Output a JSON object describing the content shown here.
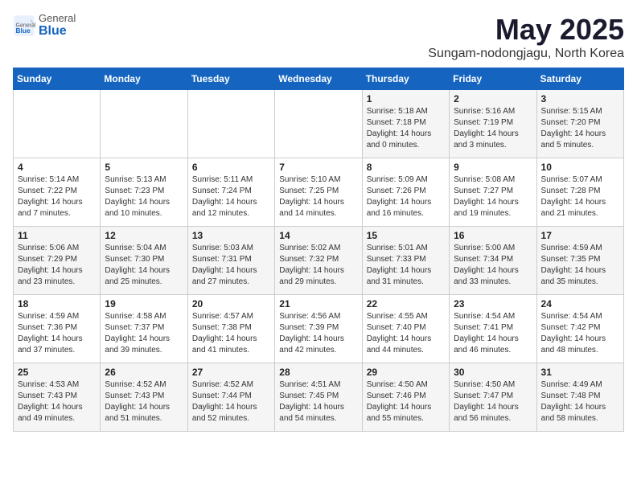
{
  "logo": {
    "general": "General",
    "blue": "Blue"
  },
  "title": "May 2025",
  "subtitle": "Sungam-nodongjagu, North Korea",
  "days_header": [
    "Sunday",
    "Monday",
    "Tuesday",
    "Wednesday",
    "Thursday",
    "Friday",
    "Saturday"
  ],
  "weeks": [
    [
      {
        "day": "",
        "text": ""
      },
      {
        "day": "",
        "text": ""
      },
      {
        "day": "",
        "text": ""
      },
      {
        "day": "",
        "text": ""
      },
      {
        "day": "1",
        "text": "Sunrise: 5:18 AM\nSunset: 7:18 PM\nDaylight: 14 hours and 0 minutes."
      },
      {
        "day": "2",
        "text": "Sunrise: 5:16 AM\nSunset: 7:19 PM\nDaylight: 14 hours and 3 minutes."
      },
      {
        "day": "3",
        "text": "Sunrise: 5:15 AM\nSunset: 7:20 PM\nDaylight: 14 hours and 5 minutes."
      }
    ],
    [
      {
        "day": "4",
        "text": "Sunrise: 5:14 AM\nSunset: 7:22 PM\nDaylight: 14 hours and 7 minutes."
      },
      {
        "day": "5",
        "text": "Sunrise: 5:13 AM\nSunset: 7:23 PM\nDaylight: 14 hours and 10 minutes."
      },
      {
        "day": "6",
        "text": "Sunrise: 5:11 AM\nSunset: 7:24 PM\nDaylight: 14 hours and 12 minutes."
      },
      {
        "day": "7",
        "text": "Sunrise: 5:10 AM\nSunset: 7:25 PM\nDaylight: 14 hours and 14 minutes."
      },
      {
        "day": "8",
        "text": "Sunrise: 5:09 AM\nSunset: 7:26 PM\nDaylight: 14 hours and 16 minutes."
      },
      {
        "day": "9",
        "text": "Sunrise: 5:08 AM\nSunset: 7:27 PM\nDaylight: 14 hours and 19 minutes."
      },
      {
        "day": "10",
        "text": "Sunrise: 5:07 AM\nSunset: 7:28 PM\nDaylight: 14 hours and 21 minutes."
      }
    ],
    [
      {
        "day": "11",
        "text": "Sunrise: 5:06 AM\nSunset: 7:29 PM\nDaylight: 14 hours and 23 minutes."
      },
      {
        "day": "12",
        "text": "Sunrise: 5:04 AM\nSunset: 7:30 PM\nDaylight: 14 hours and 25 minutes."
      },
      {
        "day": "13",
        "text": "Sunrise: 5:03 AM\nSunset: 7:31 PM\nDaylight: 14 hours and 27 minutes."
      },
      {
        "day": "14",
        "text": "Sunrise: 5:02 AM\nSunset: 7:32 PM\nDaylight: 14 hours and 29 minutes."
      },
      {
        "day": "15",
        "text": "Sunrise: 5:01 AM\nSunset: 7:33 PM\nDaylight: 14 hours and 31 minutes."
      },
      {
        "day": "16",
        "text": "Sunrise: 5:00 AM\nSunset: 7:34 PM\nDaylight: 14 hours and 33 minutes."
      },
      {
        "day": "17",
        "text": "Sunrise: 4:59 AM\nSunset: 7:35 PM\nDaylight: 14 hours and 35 minutes."
      }
    ],
    [
      {
        "day": "18",
        "text": "Sunrise: 4:59 AM\nSunset: 7:36 PM\nDaylight: 14 hours and 37 minutes."
      },
      {
        "day": "19",
        "text": "Sunrise: 4:58 AM\nSunset: 7:37 PM\nDaylight: 14 hours and 39 minutes."
      },
      {
        "day": "20",
        "text": "Sunrise: 4:57 AM\nSunset: 7:38 PM\nDaylight: 14 hours and 41 minutes."
      },
      {
        "day": "21",
        "text": "Sunrise: 4:56 AM\nSunset: 7:39 PM\nDaylight: 14 hours and 42 minutes."
      },
      {
        "day": "22",
        "text": "Sunrise: 4:55 AM\nSunset: 7:40 PM\nDaylight: 14 hours and 44 minutes."
      },
      {
        "day": "23",
        "text": "Sunrise: 4:54 AM\nSunset: 7:41 PM\nDaylight: 14 hours and 46 minutes."
      },
      {
        "day": "24",
        "text": "Sunrise: 4:54 AM\nSunset: 7:42 PM\nDaylight: 14 hours and 48 minutes."
      }
    ],
    [
      {
        "day": "25",
        "text": "Sunrise: 4:53 AM\nSunset: 7:43 PM\nDaylight: 14 hours and 49 minutes."
      },
      {
        "day": "26",
        "text": "Sunrise: 4:52 AM\nSunset: 7:43 PM\nDaylight: 14 hours and 51 minutes."
      },
      {
        "day": "27",
        "text": "Sunrise: 4:52 AM\nSunset: 7:44 PM\nDaylight: 14 hours and 52 minutes."
      },
      {
        "day": "28",
        "text": "Sunrise: 4:51 AM\nSunset: 7:45 PM\nDaylight: 14 hours and 54 minutes."
      },
      {
        "day": "29",
        "text": "Sunrise: 4:50 AM\nSunset: 7:46 PM\nDaylight: 14 hours and 55 minutes."
      },
      {
        "day": "30",
        "text": "Sunrise: 4:50 AM\nSunset: 7:47 PM\nDaylight: 14 hours and 56 minutes."
      },
      {
        "day": "31",
        "text": "Sunrise: 4:49 AM\nSunset: 7:48 PM\nDaylight: 14 hours and 58 minutes."
      }
    ]
  ]
}
